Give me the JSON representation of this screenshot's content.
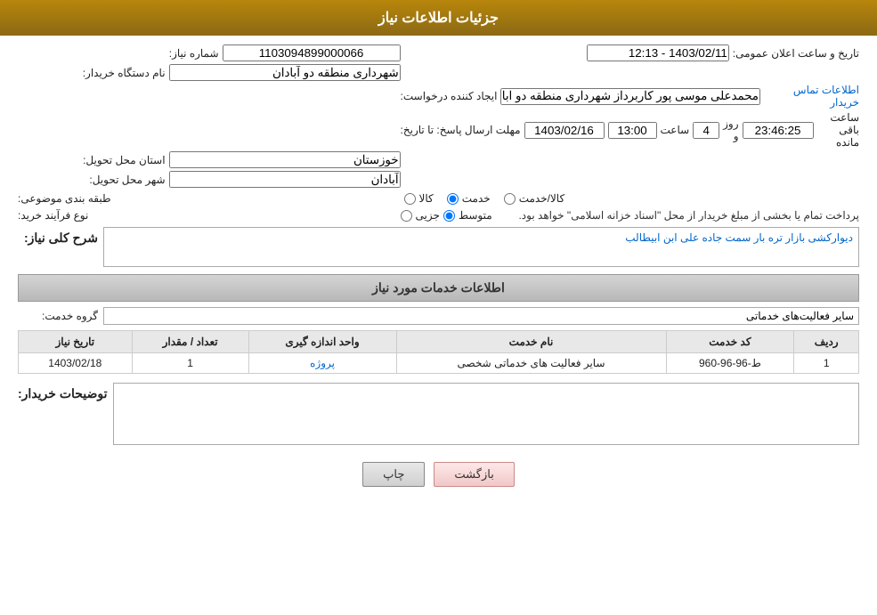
{
  "header": {
    "title": "جزئیات اطلاعات نیاز"
  },
  "fields": {
    "need_number_label": "شماره نیاز:",
    "need_number_value": "1103094899000066",
    "buyer_org_label": "نام دستگاه خریدار:",
    "buyer_org_value": "شهرداری منطقه دو آبادان",
    "announce_date_label": "تاریخ و ساعت اعلان عمومی:",
    "announce_date_value": "1403/02/11 - 12:13",
    "requester_label": "ایجاد کننده درخواست:",
    "requester_value": "محمدعلی موسی پور کاربرداز شهرداری منطقه دو آبادان",
    "contact_link": "اطلاعات تماس خریدار",
    "response_deadline_label": "مهلت ارسال پاسخ: تا تاریخ:",
    "response_date_value": "1403/02/16",
    "response_time_label": "ساعت",
    "response_time_value": "13:00",
    "response_days_label": "روز و",
    "response_days_value": "4",
    "remaining_label": "ساعت باقی مانده",
    "remaining_value": "23:46:25",
    "province_label": "استان محل تحویل:",
    "province_value": "خوزستان",
    "city_label": "شهر محل تحویل:",
    "city_value": "آبادان",
    "category_label": "طبقه بندی موضوعی:",
    "category_options": [
      "کالا",
      "خدمت",
      "کالا/خدمت"
    ],
    "category_selected": "خدمت",
    "purchase_type_label": "نوع فرآیند خرید:",
    "purchase_options": [
      "جزیی",
      "متوسط"
    ],
    "purchase_selected": "متوسط",
    "purchase_note": "پرداخت تمام یا بخشی از مبلغ خریدار از محل \"اسناد خزانه اسلامی\" خواهد بود.",
    "description_label": "شرح کلی نیاز:",
    "description_value": "دیوارکشی بازار تره بار سمت جاده علی ابن ابیطالب",
    "services_section_label": "اطلاعات خدمات مورد نیاز",
    "service_group_label": "گروه خدمت:",
    "service_group_value": "سایر فعالیت‌های خدماتی",
    "table": {
      "headers": [
        "ردیف",
        "کد خدمت",
        "نام خدمت",
        "واحد اندازه گیری",
        "تعداد / مقدار",
        "تاریخ نیاز"
      ],
      "rows": [
        {
          "row": "1",
          "code": "ط-96-96-960",
          "name": "سایر فعالیت های خدماتی شخصی",
          "unit": "پروژه",
          "quantity": "1",
          "date": "1403/02/18"
        }
      ]
    },
    "buyer_desc_label": "توضیحات خریدار:",
    "buyer_desc_value": ""
  },
  "buttons": {
    "print_label": "چاپ",
    "back_label": "بازگشت"
  }
}
